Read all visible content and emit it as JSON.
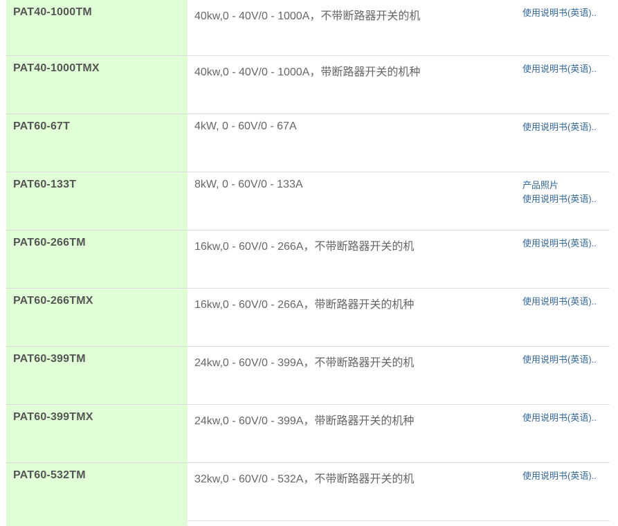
{
  "rows": [
    {
      "model": "PAT40-1000TM",
      "desc": "40kw,0 - 40V/0 - 1000A，不带断路器开关的机",
      "links": [
        "使用说明书(英语).."
      ]
    },
    {
      "model": "PAT40-1000TMX",
      "desc": "40kw,0 - 40V/0 - 1000A，带断路器开关的机种",
      "links": [
        "使用说明书(英语).."
      ]
    },
    {
      "model": "PAT60-67T",
      "desc": "4kW, 0 - 60V/0 - 67A",
      "links": [
        "使用说明书(英语).."
      ]
    },
    {
      "model": "PAT60-133T",
      "desc": "8kW, 0 - 60V/0 - 133A",
      "links": [
        "产品照片",
        "使用说明书(英语).."
      ]
    },
    {
      "model": "PAT60-266TM",
      "desc": "16kw,0 - 60V/0 - 266A，不带断路器开关的机",
      "links": [
        "使用说明书(英语).."
      ]
    },
    {
      "model": "PAT60-266TMX",
      "desc": "16kw,0 - 60V/0 - 266A，带断路器开关的机种",
      "links": [
        "使用说明书(英语).."
      ]
    },
    {
      "model": "PAT60-399TM",
      "desc": "24kw,0 - 60V/0 - 399A，不带断路器开关的机",
      "links": [
        "使用说明书(英语).."
      ]
    },
    {
      "model": "PAT60-399TMX",
      "desc": "24kw,0 - 60V/0 - 399A，带断路器开关的机种",
      "links": [
        "使用说明书(英语).."
      ]
    },
    {
      "model": "PAT60-532TM",
      "desc": "32kw,0 - 60V/0 - 532A，不带断路器开关的机",
      "links": [
        "使用说明书(英语).."
      ]
    }
  ],
  "colors": {
    "model_bg": "#e0ffd6",
    "link": "#336699",
    "text": "#666666",
    "model_text": "#555555",
    "divider": "#dcdcdc"
  }
}
